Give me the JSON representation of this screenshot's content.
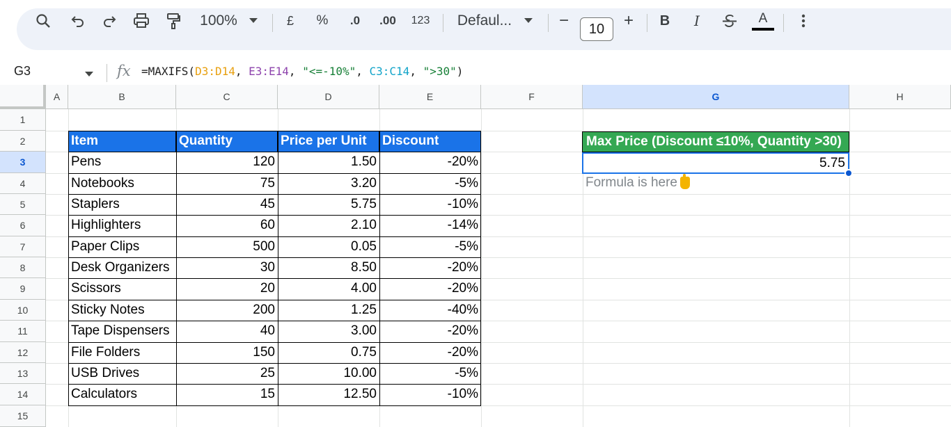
{
  "toolbar": {
    "zoom": "100%",
    "currency": "£",
    "percent": "%",
    "dec_decrease": ".0",
    "dec_increase": ".00",
    "number_format": "123",
    "font": "Defaul...",
    "font_size": "10",
    "bold": "B",
    "italic": "I",
    "text_color": "A",
    "minus": "−",
    "plus": "+"
  },
  "formula_bar": {
    "name_box": "G3",
    "fx": "fx",
    "formula_prefix": "=MAXIFS(",
    "ref1": "D3:D14",
    "sep1": ", ",
    "ref2": "E3:E14",
    "sep2": ", ",
    "str1": "\"<=-10%\"",
    "sep3": ", ",
    "ref3": "C3:C14",
    "sep4": ", ",
    "str2": "\">30\"",
    "suffix": ")"
  },
  "columns": [
    "A",
    "B",
    "C",
    "D",
    "E",
    "F",
    "G",
    "H"
  ],
  "rows": [
    "1",
    "2",
    "3",
    "4",
    "5",
    "6",
    "7",
    "8",
    "9",
    "10",
    "11",
    "12",
    "13",
    "14",
    "15"
  ],
  "table": {
    "headers": [
      "Item",
      "Quantity",
      "Price per Unit",
      "Discount"
    ],
    "rows": [
      [
        "Pens",
        "120",
        "1.50",
        "-20%"
      ],
      [
        "Notebooks",
        "75",
        "3.20",
        "-5%"
      ],
      [
        "Staplers",
        "45",
        "5.75",
        "-10%"
      ],
      [
        "Highlighters",
        "60",
        "2.10",
        "-14%"
      ],
      [
        "Paper Clips",
        "500",
        "0.05",
        "-5%"
      ],
      [
        "Desk Organizers",
        "30",
        "8.50",
        "-20%"
      ],
      [
        "Scissors",
        "20",
        "4.00",
        "-20%"
      ],
      [
        "Sticky Notes",
        "200",
        "1.25",
        "-40%"
      ],
      [
        "Tape Dispensers",
        "40",
        "3.00",
        "-20%"
      ],
      [
        "File Folders",
        "150",
        "0.75",
        "-20%"
      ],
      [
        "USB Drives",
        "25",
        "10.00",
        "-5%"
      ],
      [
        "Calculators",
        "15",
        "12.50",
        "-10%"
      ]
    ]
  },
  "result": {
    "header": "Max Price (Discount ≤10%, Quantity >30)",
    "value": "5.75",
    "note": "Formula is here"
  },
  "colors": {
    "table_header": "#1a73e8",
    "result_header": "#34a853",
    "selection": "#1a73e8"
  }
}
